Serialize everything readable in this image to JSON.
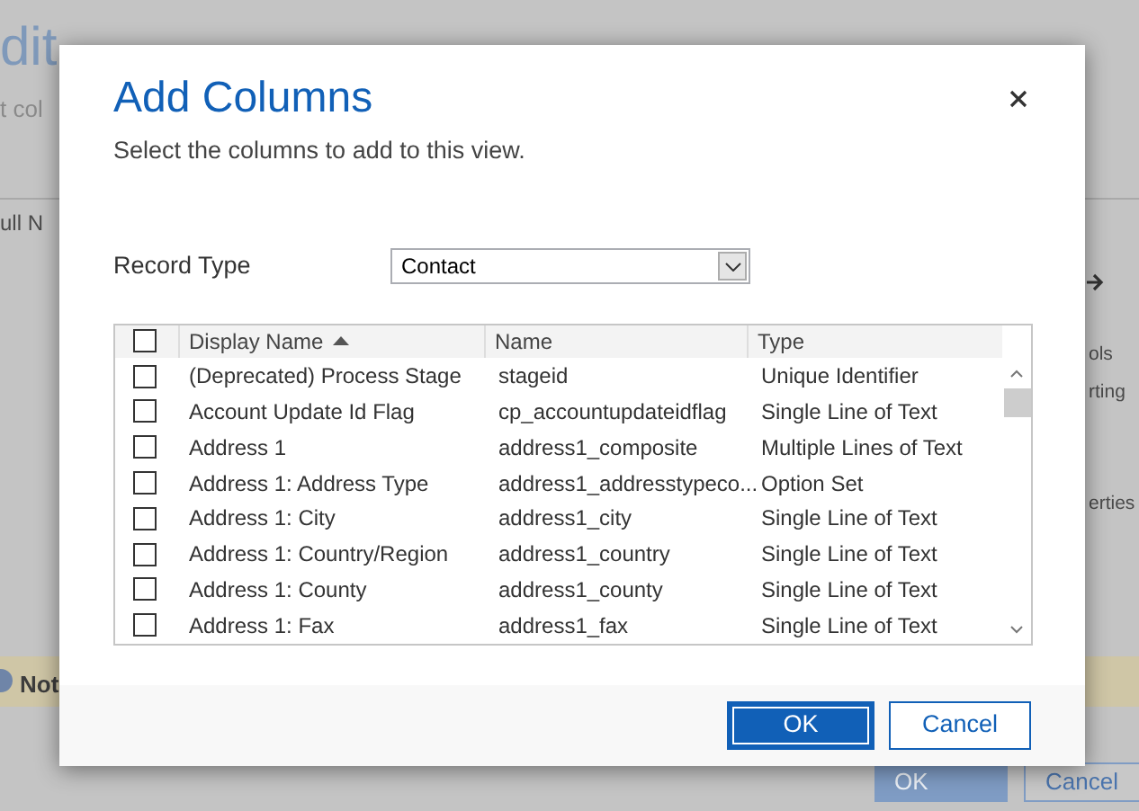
{
  "background": {
    "title": "dit",
    "subtitle": "t col",
    "column_header": "ull N",
    "right_items": [
      "ols",
      "rting",
      "erties"
    ],
    "notice": "Not",
    "buttons": [
      {
        "label": "OK",
        "primary": true
      },
      {
        "label": "Cancel",
        "primary": false
      }
    ]
  },
  "dialog": {
    "title": "Add Columns",
    "subtitle": "Select the columns to add to this view.",
    "record_type": {
      "label": "Record Type",
      "value": "Contact"
    },
    "table": {
      "select_all_checked": false,
      "columns": [
        "Display Name",
        "Name",
        "Type"
      ],
      "rows": [
        {
          "checked": false,
          "display_name": "(Deprecated) Process Stage",
          "name": "stageid",
          "type": "Unique Identifier"
        },
        {
          "checked": false,
          "display_name": "Account Update Id Flag",
          "name": "cp_accountupdateidflag",
          "type": "Single Line of Text"
        },
        {
          "checked": false,
          "display_name": "Address 1",
          "name": "address1_composite",
          "type": "Multiple Lines of Text"
        },
        {
          "checked": false,
          "display_name": "Address 1: Address Type",
          "name": "address1_addresstypeco...",
          "type": "Option Set"
        },
        {
          "checked": false,
          "display_name": "Address 1: City",
          "name": "address1_city",
          "type": "Single Line of Text"
        },
        {
          "checked": false,
          "display_name": "Address 1: Country/Region",
          "name": "address1_country",
          "type": "Single Line of Text"
        },
        {
          "checked": false,
          "display_name": "Address 1: County",
          "name": "address1_county",
          "type": "Single Line of Text"
        },
        {
          "checked": false,
          "display_name": "Address 1: Fax",
          "name": "address1_fax",
          "type": "Single Line of Text"
        }
      ]
    },
    "buttons": [
      {
        "label": "OK",
        "primary": true
      },
      {
        "label": "Cancel",
        "primary": false
      }
    ]
  }
}
